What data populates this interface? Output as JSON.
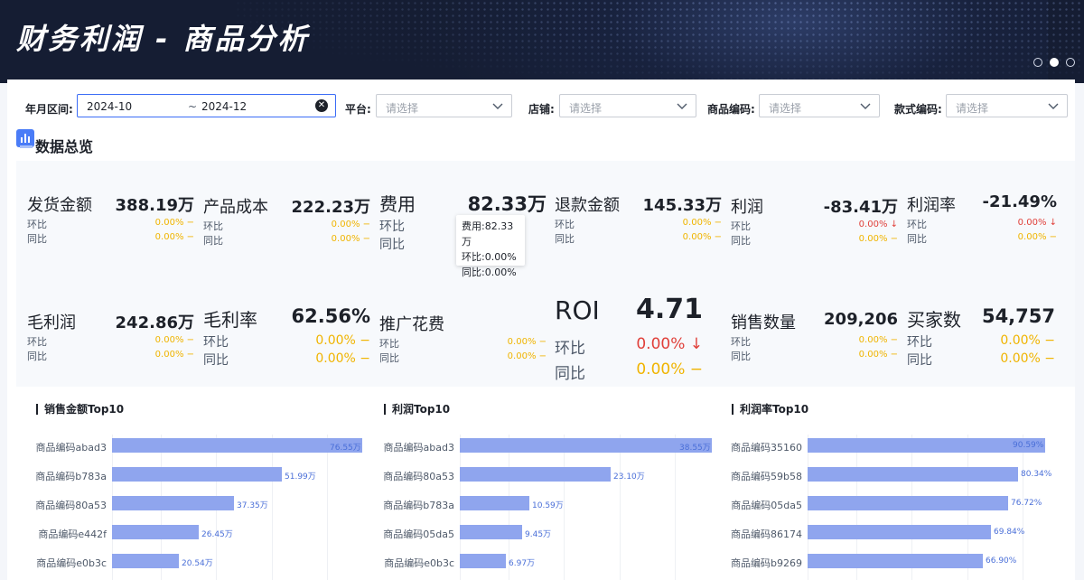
{
  "header": {
    "title": "财务利润 - 商品分析",
    "pager_count": 3,
    "pager_active": 1
  },
  "filters": {
    "date_label": "年月区间:",
    "date_start": "2024-10",
    "date_sep": "~",
    "date_end": "2024-12",
    "platform_label": "平台:",
    "platform_placeholder": "请选择",
    "store_label": "店铺:",
    "store_placeholder": "请选择",
    "product_code_label": "商品编码:",
    "product_code_placeholder": "请选择",
    "style_code_label": "款式编码:",
    "style_code_placeholder": "请选择"
  },
  "overview": {
    "title": "数据总览",
    "kpis": [
      {
        "name": "发货金额",
        "value": "388.19万",
        "mom_label": "环比",
        "mom": "0.00% −",
        "yoy_label": "同比",
        "yoy": "0.00% −"
      },
      {
        "name": "产品成本",
        "value": "222.23万",
        "mom_label": "环比",
        "mom": "0.00% −",
        "yoy_label": "同比",
        "yoy": "0.00% −"
      },
      {
        "name": "费用",
        "value": "82.33万",
        "mom_label": "环比",
        "mom": "",
        "yoy_label": "同比",
        "yoy": ""
      },
      {
        "name": "退款金额",
        "value": "145.33万",
        "mom_label": "环比",
        "mom": "0.00% −",
        "yoy_label": "同比",
        "yoy": "0.00% −"
      },
      {
        "name": "利润",
        "value": "-83.41万",
        "mom_label": "环比",
        "mom": "0.00% ↓",
        "yoy_label": "同比",
        "yoy": "0.00% −"
      },
      {
        "name": "利润率",
        "value": "-21.49%",
        "mom_label": "环比",
        "mom": "0.00% ↓",
        "yoy_label": "同比",
        "yoy": "0.00% −"
      },
      {
        "name": "毛利润",
        "value": "242.86万",
        "mom_label": "环比",
        "mom": "0.00% −",
        "yoy_label": "同比",
        "yoy": "0.00% −"
      },
      {
        "name": "毛利率",
        "value": "62.56%",
        "mom_label": "环比",
        "mom": "0.00% −",
        "yoy_label": "同比",
        "yoy": "0.00% −"
      },
      {
        "name": "推广花费",
        "value": "",
        "mom_label": "环比",
        "mom": "0.00% −",
        "yoy_label": "同比",
        "yoy": "0.00% −"
      },
      {
        "name": "ROI",
        "value": "4.71",
        "mom_label": "环比",
        "mom": "0.00% ↓",
        "yoy_label": "同比",
        "yoy": "0.00% −"
      },
      {
        "name": "销售数量",
        "value": "209,206",
        "mom_label": "环比",
        "mom": "0.00% −",
        "yoy_label": "同比",
        "yoy": "0.00% −"
      },
      {
        "name": "买家数",
        "value": "54,757",
        "mom_label": "环比",
        "mom": "0.00% −",
        "yoy_label": "同比",
        "yoy": "0.00% −"
      }
    ],
    "tooltip": {
      "line1": "费用:82.33万",
      "line2": "环比:0.00%",
      "line3": "同比:0.00%"
    }
  },
  "colors": {
    "bar": "#8fa5ee",
    "up_neutral": "#f0b400",
    "down": "#e0403a",
    "accent": "#3b6cf6"
  },
  "chart_data": [
    {
      "type": "bar",
      "title": "销售金额Top10",
      "categories": [
        "商品编码abad3",
        "商品编码b783a",
        "商品编码80a53",
        "商品编码e442f",
        "商品编码e0b3c"
      ],
      "values": [
        76.55,
        51.99,
        37.35,
        26.45,
        20.54
      ],
      "value_labels": [
        "76.55万",
        "51.99万",
        "37.35万",
        "26.45万",
        "20.54万"
      ],
      "xlim": [
        0,
        80
      ]
    },
    {
      "type": "bar",
      "title": "利润Top10",
      "categories": [
        "商品编码abad3",
        "商品编码80a53",
        "商品编码b783a",
        "商品编码05da5",
        "商品编码e0b3c"
      ],
      "values": [
        38.55,
        23.1,
        10.59,
        9.45,
        6.97
      ],
      "value_labels": [
        "38.55万",
        "23.10万",
        "10.59万",
        "9.45万",
        "6.97万"
      ],
      "xlim": [
        0,
        40
      ]
    },
    {
      "type": "bar",
      "title": "利润率Top10",
      "categories": [
        "商品编码35160",
        "商品编码59b58",
        "商品编码05da5",
        "商品编码86174",
        "商品编码b9269"
      ],
      "values": [
        90.59,
        80.34,
        76.72,
        69.84,
        66.9
      ],
      "value_labels": [
        "90.59%",
        "80.34%",
        "76.72%",
        "69.84%",
        "66.90%"
      ],
      "xlim": [
        0,
        100
      ]
    }
  ]
}
